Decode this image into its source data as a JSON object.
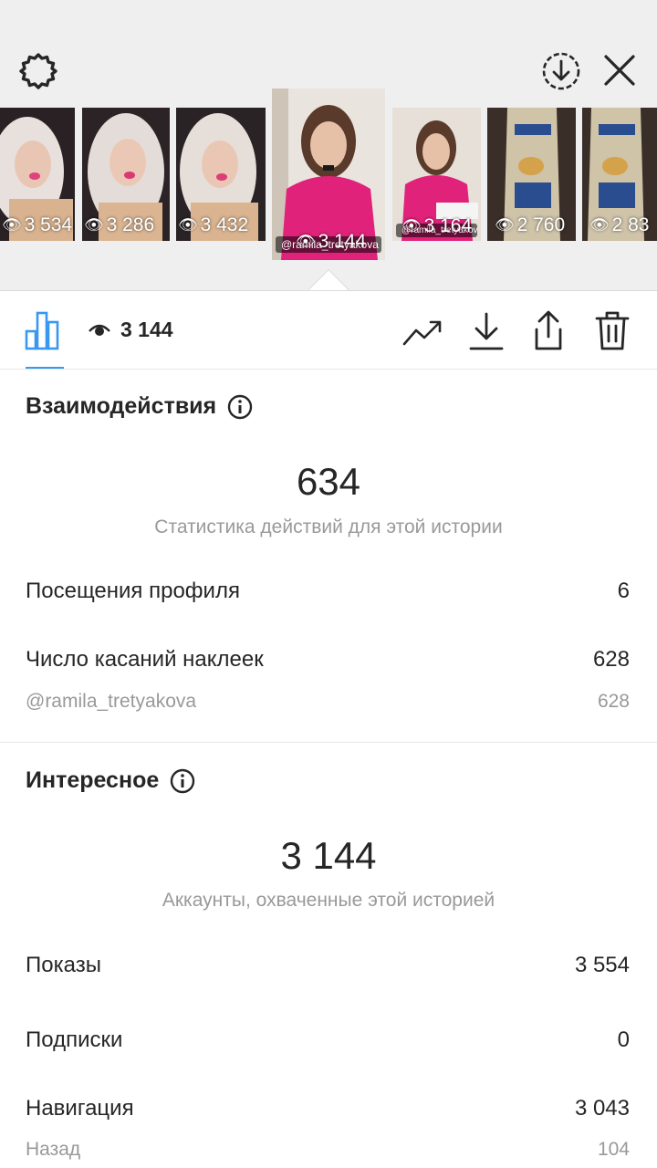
{
  "header": {
    "settings_icon": "gear-icon",
    "download_icon": "download-circle-icon",
    "close_icon": "close-icon"
  },
  "thumbnails": [
    {
      "views": "3 534",
      "kind": "blonde-woman"
    },
    {
      "views": "3 286",
      "kind": "blonde-woman"
    },
    {
      "views": "3 432",
      "kind": "blonde-woman"
    },
    {
      "views": "3 144",
      "kind": "brunette-pink",
      "handle": "@ramila_tretyakova"
    },
    {
      "views": "3 164",
      "kind": "brunette-pink",
      "handle": "@ramila_tretyakova"
    },
    {
      "views": "2 760",
      "kind": "pantene-bottle"
    },
    {
      "views": "2 83",
      "kind": "pantene-bottle"
    }
  ],
  "toolbar": {
    "views": "3 144",
    "icons": [
      "bar-chart-icon",
      "eye-icon",
      "trend-icon",
      "download-icon",
      "share-icon",
      "trash-icon"
    ]
  },
  "interactions": {
    "title": "Взаимодействия",
    "total": "634",
    "caption": "Статистика действий для этой истории",
    "rows": [
      {
        "label": "Посещения профиля",
        "value": "6"
      },
      {
        "label": "Число касаний наклеек",
        "value": "628"
      }
    ],
    "sub": {
      "label": "@ramila_tretyakova",
      "value": "628"
    }
  },
  "discovery": {
    "title": "Интересное",
    "total": "3 144",
    "caption": "Аккаунты, охваченные этой историей",
    "rows": [
      {
        "label": "Показы",
        "value": "3 554"
      },
      {
        "label": "Подписки",
        "value": "0"
      },
      {
        "label": "Навигация",
        "value": "3 043"
      }
    ],
    "sub": {
      "label": "Назад",
      "value": "104"
    }
  },
  "colors": {
    "accent": "#3897f0",
    "text": "#262626",
    "muted": "#999999",
    "background_top": "#efefef"
  }
}
